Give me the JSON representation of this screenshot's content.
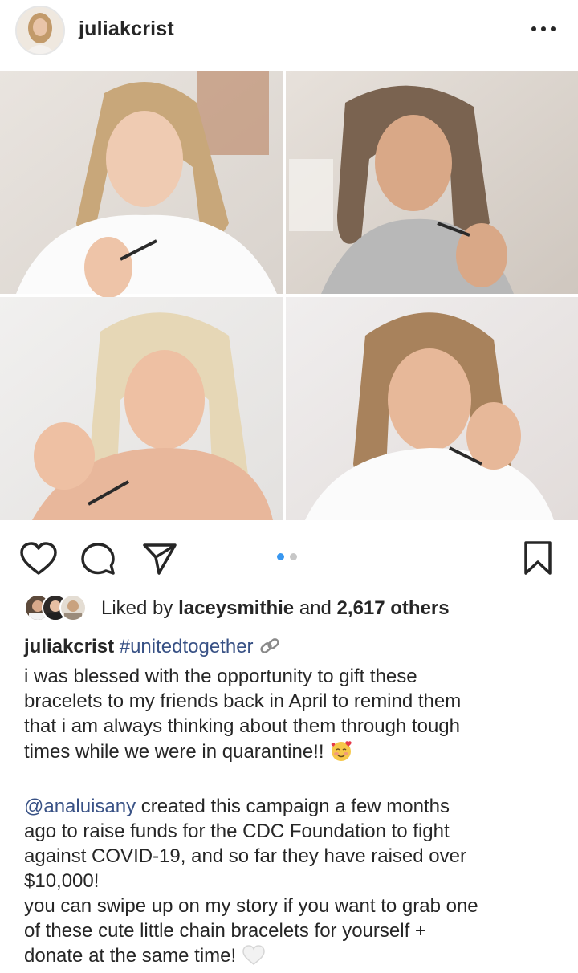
{
  "post": {
    "username": "juliakcrist",
    "more_label": "•••"
  },
  "carousel": {
    "current_index": 1,
    "total": 2,
    "active_color": "#3897f0",
    "inactive_color": "#c7c7c7"
  },
  "actions": {
    "like_icon": "heart-icon",
    "comment_icon": "comment-icon",
    "share_icon": "send-icon",
    "save_icon": "bookmark-icon"
  },
  "likes": {
    "prefix": "Liked by ",
    "liker": "laceysmithie",
    "middle": " and ",
    "others": "2,617 others"
  },
  "caption": {
    "username": "juliakcrist",
    "hashtag": "#unitedtogether",
    "line1": "i was blessed with the opportunity to gift these",
    "line2": "bracelets to my friends back in April to remind them",
    "line3": "that i am always thinking about them through tough",
    "line4": "times while we were in quarantine!!",
    "mention": "@analuisany",
    "line5_rest": " created this campaign a few months",
    "line6": "ago to raise funds for the CDC Foundation to fight",
    "line7": "against COVID-19, and so far they have raised over",
    "line8": "$10,000!",
    "line9": "you can swipe up on my story if you want to grab one",
    "line10": "of these cute little chain bracelets for yourself +",
    "line11": "donate at the same time!"
  },
  "colors": {
    "text": "#262626",
    "link": "#385185"
  }
}
